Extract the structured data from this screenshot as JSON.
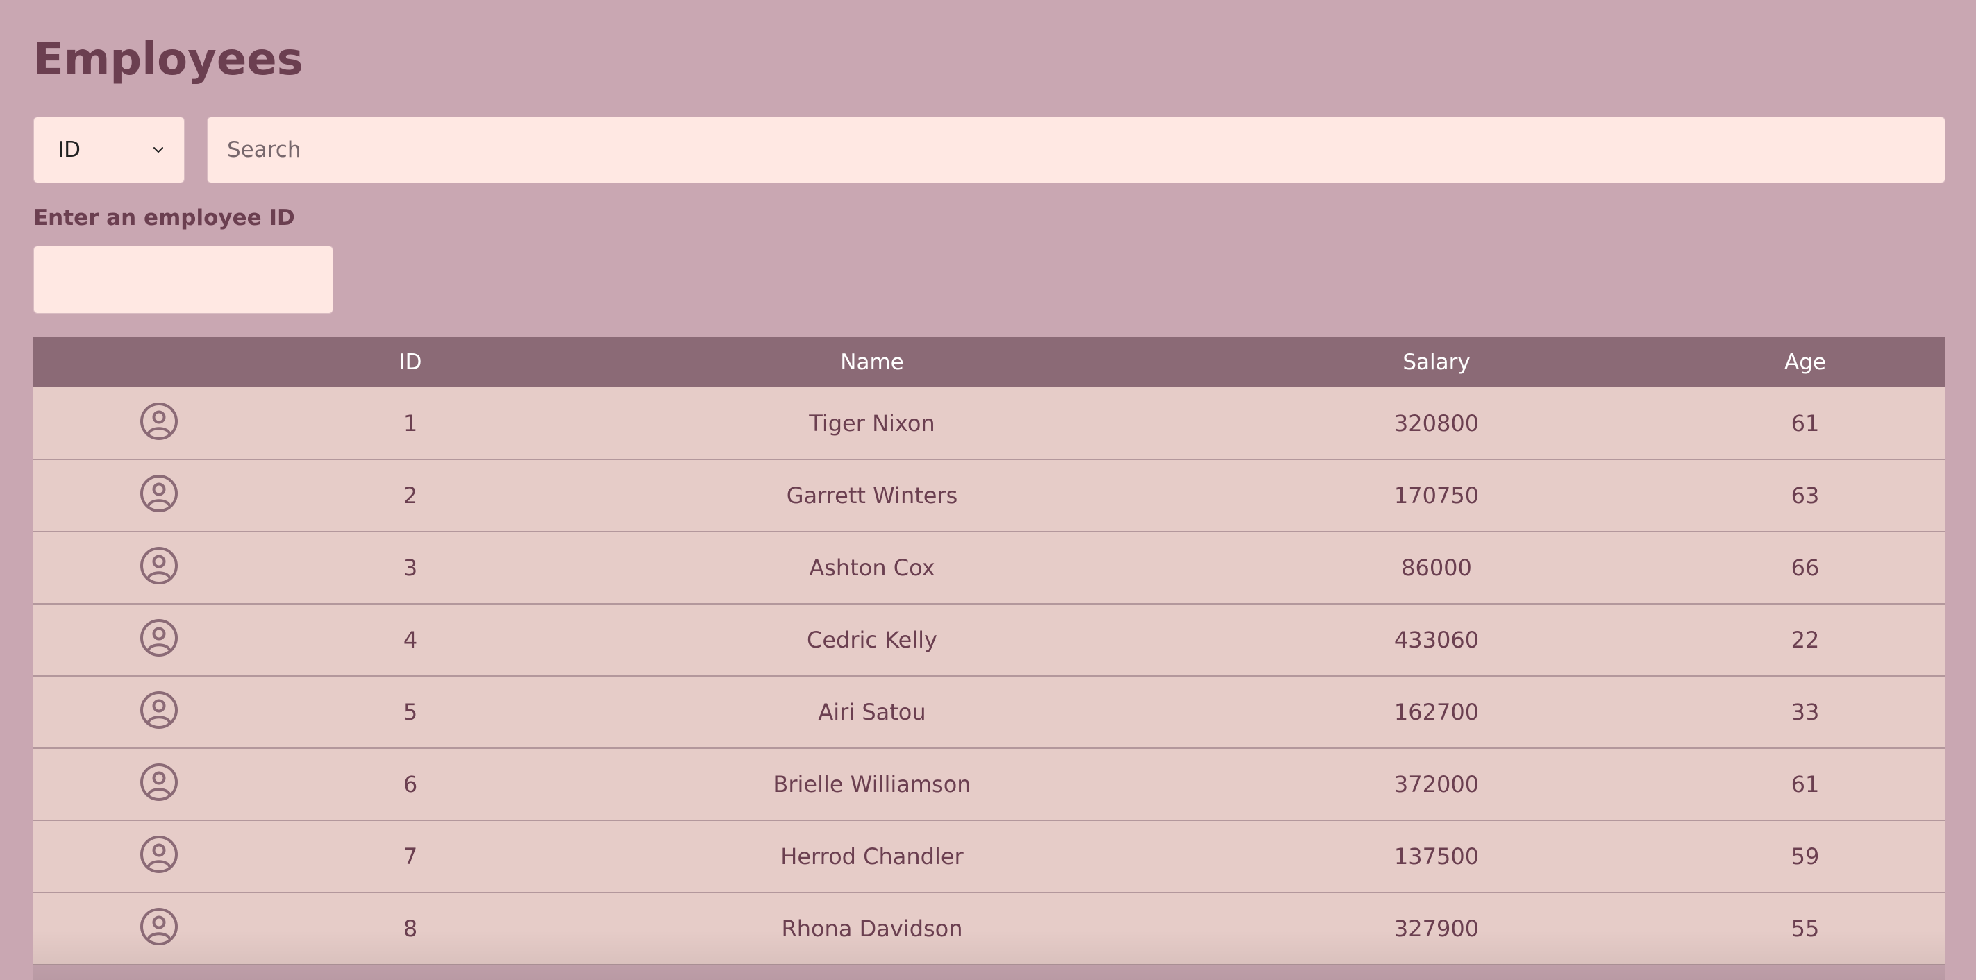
{
  "page": {
    "title": "Employees"
  },
  "filter": {
    "select_value": "ID",
    "search_placeholder": "Search",
    "id_label": "Enter an employee ID",
    "id_value": ""
  },
  "table": {
    "headers": {
      "avatar": "",
      "id": "ID",
      "name": "Name",
      "salary": "Salary",
      "age": "Age"
    },
    "rows": [
      {
        "id": "1",
        "name": "Tiger Nixon",
        "salary": "320800",
        "age": "61"
      },
      {
        "id": "2",
        "name": "Garrett Winters",
        "salary": "170750",
        "age": "63"
      },
      {
        "id": "3",
        "name": "Ashton Cox",
        "salary": "86000",
        "age": "66"
      },
      {
        "id": "4",
        "name": "Cedric Kelly",
        "salary": "433060",
        "age": "22"
      },
      {
        "id": "5",
        "name": "Airi Satou",
        "salary": "162700",
        "age": "33"
      },
      {
        "id": "6",
        "name": "Brielle Williamson",
        "salary": "372000",
        "age": "61"
      },
      {
        "id": "7",
        "name": "Herrod Chandler",
        "salary": "137500",
        "age": "59"
      },
      {
        "id": "8",
        "name": "Rhona Davidson",
        "salary": "327900",
        "age": "55"
      }
    ]
  },
  "icons": {
    "row_avatar": "user-circle-icon",
    "select_chevron": "chevron-down-icon"
  },
  "colors": {
    "background": "#c9a7b2",
    "title": "#6b3f50",
    "header_bg": "#8b6a76",
    "row_bg": "#e6ccc8",
    "input_bg": "#ffe8e3"
  }
}
